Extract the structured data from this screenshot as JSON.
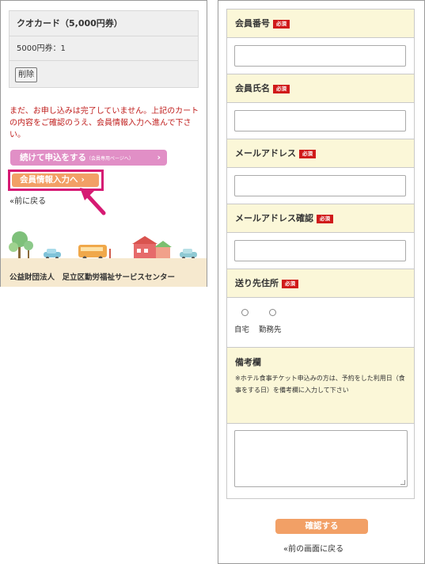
{
  "cart": {
    "title": "クオカード（5,000円券）",
    "qty_label": "5000円券：1",
    "delete_label": "削除"
  },
  "notice": "まだ、お申し込みは完了していません。上記のカートの内容をご確認のうえ、会員情報入力へ進んで下さい。",
  "buttons": {
    "continue_main": "続けて申込をする",
    "continue_sub": "（会員専用ページへ）",
    "continue_chevron": "›",
    "member_info": "会員情報入力へ",
    "member_chevron": "›",
    "back": "«前に戻る"
  },
  "footer": {
    "org": "公益財団法人　足立区勤労福祉サービスセンター"
  },
  "form": {
    "required_badge": "必須",
    "member_number_label": "会員番号",
    "member_name_label": "会員氏名",
    "email_label": "メールアドレス",
    "email_confirm_label": "メールアドレス確認",
    "delivery_label": "送り先住所",
    "delivery_options": [
      "自宅",
      "勤務先"
    ],
    "notes_label": "備考欄",
    "notes_help": "※ホテル食事チケット申込みの方は、予約をした利用日（食事をする日）を備考欄に入力して下さい",
    "confirm_button": "確認する",
    "back_link": "«前の画面に戻る"
  },
  "colors": {
    "required": "#d01a1a",
    "notice_text": "#c0201f",
    "pink_button": "#e18fc6",
    "orange_button": "#f2a066",
    "highlight_border": "#d61a73",
    "label_bg": "#fbf7d8",
    "footer_band": "#f6e9cf"
  }
}
